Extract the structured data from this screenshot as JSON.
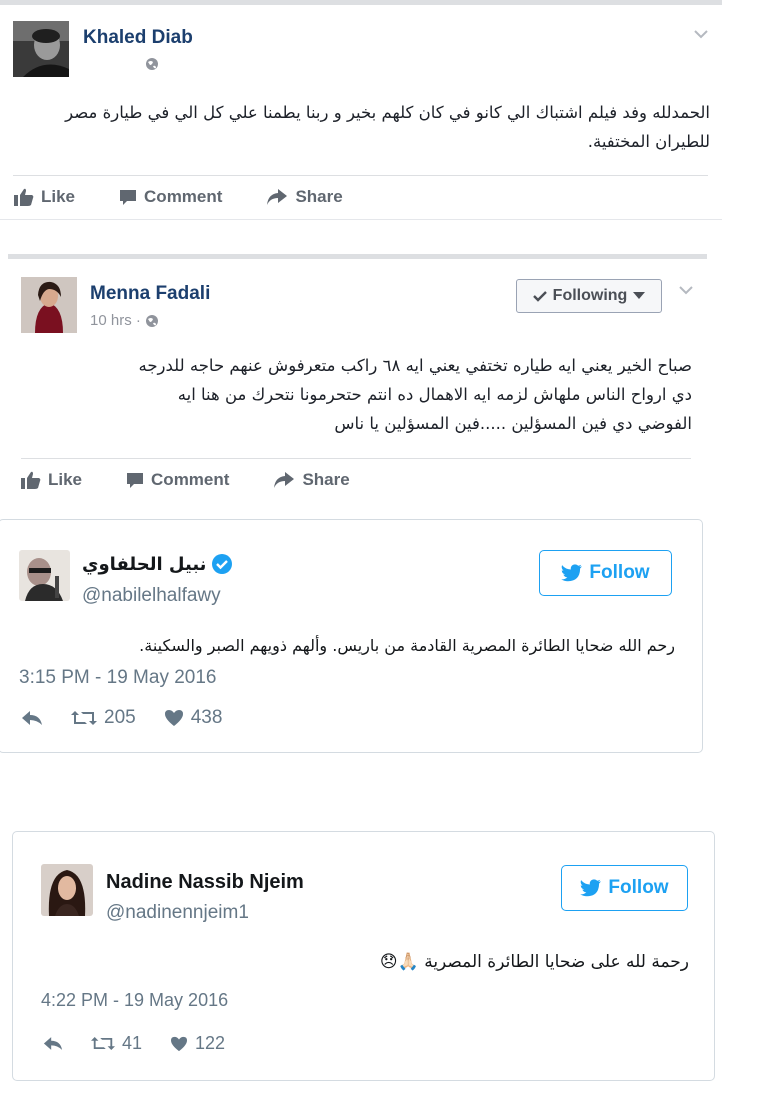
{
  "post1": {
    "author": "Khaled Diab",
    "text": "الحمدلله وفد فيلم اشتباك الي كانو في كان كلهم بخير و ربنا يطمنا علي كل الي في طيارة مصر للطيران المختفية.",
    "actions": {
      "like": "Like",
      "comment": "Comment",
      "share": "Share"
    }
  },
  "post2": {
    "author": "Menna Fadali",
    "time": "10 hrs ·",
    "following_label": "Following",
    "text_lines": [
      "صباح الخير يعني ايه طياره تختفي يعني ايه ٦٨ راكب متعرفوش عنهم حاجه للدرجه",
      "دي ارواح الناس ملهاش لزمه ايه الاهمال ده انتم حتحرمونا نتحرك من هنا ايه",
      "الفوضي دي فين المسؤلين .....فين المسؤلين يا ناس"
    ],
    "actions": {
      "like": "Like",
      "comment": "Comment",
      "share": "Share"
    }
  },
  "tweet1": {
    "name": "نبيل الحلفاوي",
    "handle": "@nabilelhalfawy",
    "follow_label": "Follow",
    "text": "رحم الله ضحايا الطائرة المصرية القادمة من باريس. وألهم ذويهم الصبر والسكينة.",
    "timestamp": "3:15 PM - 19 May 2016",
    "retweets": "205",
    "likes": "438"
  },
  "tweet2": {
    "name": "Nadine Nassib Njeim",
    "handle": "@nadinennjeim1",
    "follow_label": "Follow",
    "text": "رحمة لله على ضحايا الطائرة المصرية",
    "emoji": "🙏🏻😞",
    "timestamp": "4:22 PM - 19 May 2016",
    "retweets": "41",
    "likes": "122"
  },
  "icons": [
    "globe-icon",
    "chevron-down-icon",
    "thumbs-up-icon",
    "comment-icon",
    "share-icon",
    "check-icon",
    "caret-down-icon",
    "verified-badge-icon",
    "twitter-bird-icon",
    "reply-icon",
    "retweet-icon",
    "heart-icon"
  ],
  "colors": {
    "fb_name": "#1c3f6e",
    "twitter_blue": "#1da1f2",
    "verified": "#1da1f2",
    "muted": "#657786"
  }
}
